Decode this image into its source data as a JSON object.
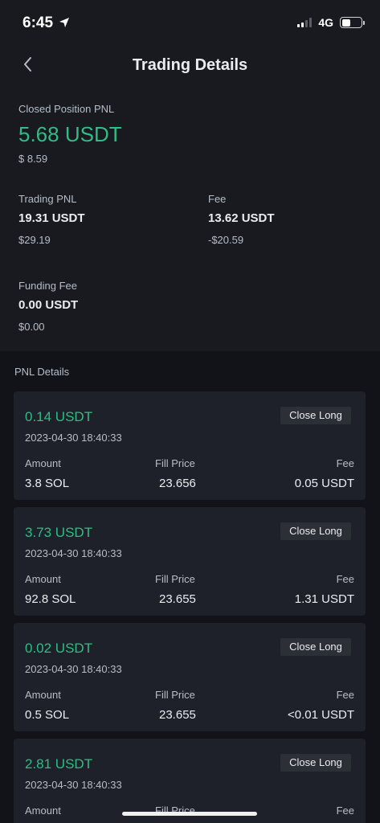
{
  "status": {
    "time": "6:45",
    "network": "4G"
  },
  "header": {
    "title": "Trading Details"
  },
  "summary": {
    "closed_label": "Closed Position PNL",
    "closed_value": "5.68 USDT",
    "closed_usd": "$ 8.59",
    "trading_label": "Trading PNL",
    "trading_value": "19.31 USDT",
    "trading_usd": "$29.19",
    "fee_label": "Fee",
    "fee_value": "13.62 USDT",
    "fee_usd": "-$20.59",
    "funding_label": "Funding Fee",
    "funding_value": "0.00 USDT",
    "funding_usd": "$0.00"
  },
  "details": {
    "title": "PNL Details",
    "col_amount": "Amount",
    "col_price": "Fill Price",
    "col_fee": "Fee",
    "items": [
      {
        "pnl": "0.14 USDT",
        "time": "2023-04-30 18:40:33",
        "tag": "Close Long",
        "amount": "3.8 SOL",
        "price": "23.656",
        "fee": "0.05 USDT"
      },
      {
        "pnl": "3.73 USDT",
        "time": "2023-04-30 18:40:33",
        "tag": "Close Long",
        "amount": "92.8 SOL",
        "price": "23.655",
        "fee": "1.31 USDT"
      },
      {
        "pnl": "0.02 USDT",
        "time": "2023-04-30 18:40:33",
        "tag": "Close Long",
        "amount": "0.5 SOL",
        "price": "23.655",
        "fee": "<0.01 USDT"
      },
      {
        "pnl": "2.81 USDT",
        "time": "2023-04-30 18:40:33",
        "tag": "Close Long",
        "amount": "",
        "price": "",
        "fee": ""
      }
    ]
  },
  "colors": {
    "background": "#181a20",
    "details_background": "#111318",
    "card": "#1e2129",
    "positive": "#2ebd85",
    "text": "#eaecef",
    "muted": "#b7bdc6"
  },
  "icons": {
    "back": "chevron-left-icon",
    "location": "location-arrow-icon"
  }
}
